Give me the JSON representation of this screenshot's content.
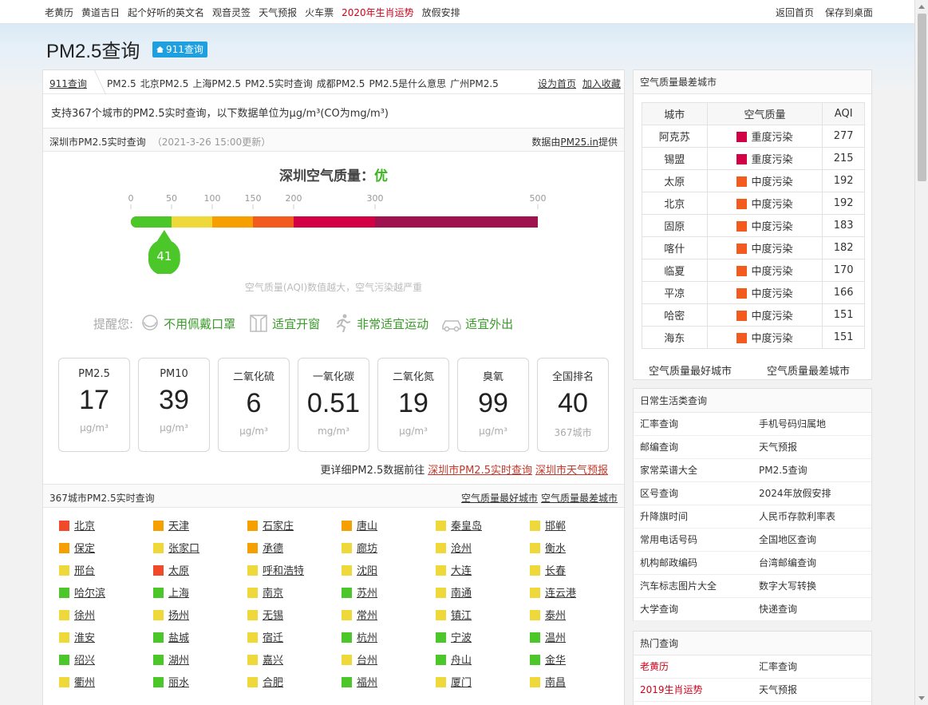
{
  "topnav": {
    "links": [
      "老黄历",
      "黄道吉日",
      "起个好听的英文名",
      "观音灵签",
      "天气预报",
      "火车票",
      "2020年生肖运势",
      "放假安排"
    ],
    "highlight_index": 6,
    "right": [
      "返回首页",
      "保存到桌面"
    ]
  },
  "page": {
    "title": "PM2.5查询",
    "badge": "911查询"
  },
  "breadcrumb": {
    "home": "911查询",
    "items": [
      "PM2.5",
      "北京PM2.5",
      "上海PM2.5",
      "PM2.5实时查询",
      "成都PM2.5",
      "PM2.5是什么意思",
      "广州PM2.5"
    ],
    "right": [
      "设为首页",
      "加入收藏"
    ]
  },
  "intro": "支持367个城市的PM2.5实时查询，以下数据单位为μg/m³(CO为mg/m³)",
  "current": {
    "heading": "深圳市PM2.5实时查询",
    "updated": "（2021-3-26 15:00更新）",
    "source_prefix": "数据由",
    "source_link": "PM25.in",
    "source_suffix": "提供",
    "title_label": "深圳空气质量：",
    "level": "优",
    "aqi": 41,
    "scale_ticks": [
      0,
      50,
      100,
      150,
      200,
      300,
      500
    ],
    "scale_colors": [
      "#4cc72a",
      "#efd93a",
      "#f5a000",
      "#f25a1e",
      "#d20045",
      "#9e1250"
    ],
    "note": "空气质量(AQI)数值越大，空气污染越严重"
  },
  "tips": {
    "label": "提醒您:",
    "items": [
      "不用佩戴口罩",
      "适宜开窗",
      "非常适宜运动",
      "适宜外出"
    ]
  },
  "pollutants": [
    {
      "name": "PM2.5",
      "value": "17",
      "unit": "μg/m³"
    },
    {
      "name": "PM10",
      "value": "39",
      "unit": "μg/m³"
    },
    {
      "name": "二氧化硫",
      "value": "6",
      "unit": "μg/m³"
    },
    {
      "name": "一氧化碳",
      "value": "0.51",
      "unit": "mg/m³"
    },
    {
      "name": "二氧化氮",
      "value": "19",
      "unit": "μg/m³"
    },
    {
      "name": "臭氧",
      "value": "99",
      "unit": "μg/m³"
    },
    {
      "name": "全国排名",
      "value": "40",
      "unit": "367城市"
    }
  ],
  "more": {
    "prefix": "更详细PM2.5数据前往",
    "links": [
      "深圳市PM2.5实时查询",
      "深圳市天气预报"
    ]
  },
  "cities": {
    "heading": "367城市PM2.5实时查询",
    "right": [
      "空气质量最好城市",
      "空气质量最差城市"
    ],
    "list": [
      [
        "北京",
        "#f04a2a"
      ],
      [
        "天津",
        "#f5a000"
      ],
      [
        "石家庄",
        "#f5a000"
      ],
      [
        "唐山",
        "#f5a000"
      ],
      [
        "秦皇岛",
        "#efd93a"
      ],
      [
        "邯郸",
        "#efd93a"
      ],
      [
        "保定",
        "#f5a000"
      ],
      [
        "张家口",
        "#efd93a"
      ],
      [
        "承德",
        "#f5a000"
      ],
      [
        "廊坊",
        "#efd93a"
      ],
      [
        "沧州",
        "#efd93a"
      ],
      [
        "衡水",
        "#efd93a"
      ],
      [
        "邢台",
        "#efd93a"
      ],
      [
        "太原",
        "#f04a2a"
      ],
      [
        "呼和浩特",
        "#efd93a"
      ],
      [
        "沈阳",
        "#efd93a"
      ],
      [
        "大连",
        "#efd93a"
      ],
      [
        "长春",
        "#efd93a"
      ],
      [
        "哈尔滨",
        "#4cc72a"
      ],
      [
        "上海",
        "#4cc72a"
      ],
      [
        "南京",
        "#efd93a"
      ],
      [
        "苏州",
        "#4cc72a"
      ],
      [
        "南通",
        "#efd93a"
      ],
      [
        "连云港",
        "#efd93a"
      ],
      [
        "徐州",
        "#efd93a"
      ],
      [
        "扬州",
        "#efd93a"
      ],
      [
        "无锡",
        "#efd93a"
      ],
      [
        "常州",
        "#efd93a"
      ],
      [
        "镇江",
        "#efd93a"
      ],
      [
        "泰州",
        "#efd93a"
      ],
      [
        "淮安",
        "#efd93a"
      ],
      [
        "盐城",
        "#4cc72a"
      ],
      [
        "宿迁",
        "#efd93a"
      ],
      [
        "杭州",
        "#4cc72a"
      ],
      [
        "宁波",
        "#4cc72a"
      ],
      [
        "温州",
        "#4cc72a"
      ],
      [
        "绍兴",
        "#4cc72a"
      ],
      [
        "湖州",
        "#4cc72a"
      ],
      [
        "嘉兴",
        "#efd93a"
      ],
      [
        "台州",
        "#efd93a"
      ],
      [
        "舟山",
        "#4cc72a"
      ],
      [
        "金华",
        "#4cc72a"
      ],
      [
        "衢州",
        "#efd93a"
      ],
      [
        "丽水",
        "#4cc72a"
      ],
      [
        "合肥",
        "#efd93a"
      ],
      [
        "福州",
        "#4cc72a"
      ],
      [
        "厦门",
        "#efd93a"
      ],
      [
        "南昌",
        "#efd93a"
      ]
    ]
  },
  "worst": {
    "heading": "空气质量最差城市",
    "cols": [
      "城市",
      "空气质量",
      "AQI"
    ],
    "rows": [
      [
        "阿克苏",
        "重度污染",
        "277",
        "#d20045"
      ],
      [
        "锡盟",
        "重度污染",
        "215",
        "#d20045"
      ],
      [
        "太原",
        "中度污染",
        "192",
        "#f25a1e"
      ],
      [
        "北京",
        "中度污染",
        "192",
        "#f25a1e"
      ],
      [
        "固原",
        "中度污染",
        "183",
        "#f25a1e"
      ],
      [
        "喀什",
        "中度污染",
        "182",
        "#f25a1e"
      ],
      [
        "临夏",
        "中度污染",
        "170",
        "#f25a1e"
      ],
      [
        "平凉",
        "中度污染",
        "166",
        "#f25a1e"
      ],
      [
        "哈密",
        "中度污染",
        "151",
        "#f25a1e"
      ],
      [
        "海东",
        "中度污染",
        "151",
        "#f25a1e"
      ]
    ],
    "footer": [
      "空气质量最好城市",
      "空气质量最差城市"
    ]
  },
  "life": {
    "heading": "日常生活类查询",
    "rows": [
      [
        "汇率查询",
        "手机号码归属地"
      ],
      [
        "邮编查询",
        "天气预报"
      ],
      [
        "家常菜谱大全",
        "PM2.5查询"
      ],
      [
        "区号查询",
        "2024年放假安排"
      ],
      [
        "升降旗时间",
        "人民币存款利率表"
      ],
      [
        "常用电话号码",
        "全国地区查询"
      ],
      [
        "机构邮政编码",
        "台湾邮编查询"
      ],
      [
        "汽车标志图片大全",
        "数字大写转换"
      ],
      [
        "大学查询",
        "快递查询"
      ]
    ]
  },
  "hot": {
    "heading": "热门查询",
    "rows": [
      [
        "老黄历",
        "汇率查询"
      ],
      [
        "2019生肖运势",
        "天气预报"
      ]
    ]
  }
}
